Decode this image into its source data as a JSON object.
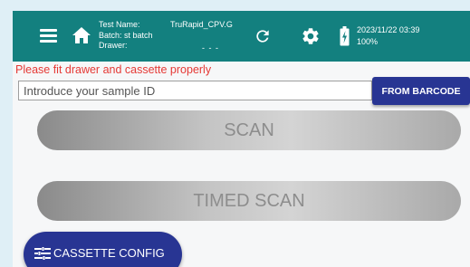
{
  "colors": {
    "app_bar": "#13807f",
    "primary_button": "#283593",
    "warning_text": "#e53935",
    "disabled_text": "#8d8d8d"
  },
  "header": {
    "menu_icon": "hamburger-menu-icon",
    "home_icon": "home-icon",
    "test_name_label": "Test Name:",
    "test_name_value": "TruRapid_CPV.G",
    "batch_label": "Batch: st batch",
    "drawer_label": "Drawer:",
    "drawer_value": "- - -",
    "refresh_icon": "refresh-icon",
    "settings_icon": "gear-icon",
    "battery_icon": "battery-charging-icon",
    "datetime": "2023/11/22 03:39",
    "battery_percent": "100%"
  },
  "main": {
    "warning_message": "Please fit drawer and cassette properly",
    "sample_input": {
      "placeholder": "Introduce your sample ID",
      "value": ""
    },
    "barcode_button_label": "FROM BARCODE",
    "scan_button_label": "SCAN",
    "timed_scan_button_label": "TIMED SCAN",
    "cassette_config_button_label": "CASSETTE CONFIG",
    "cassette_config_icon": "tune-icon"
  }
}
